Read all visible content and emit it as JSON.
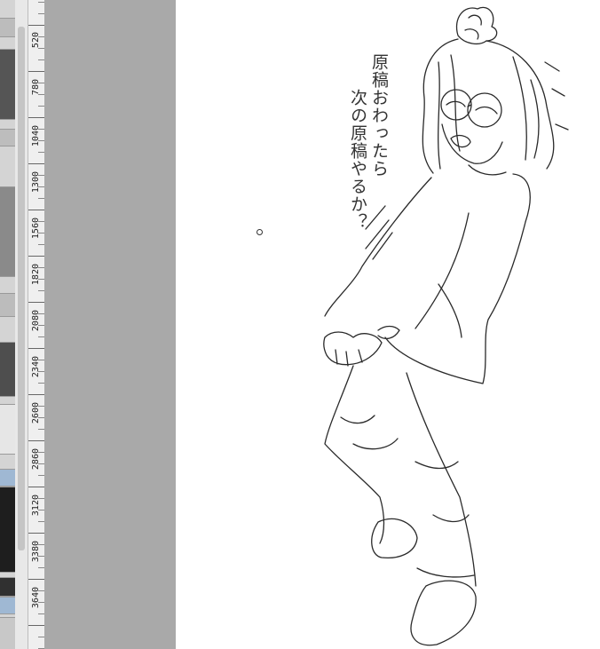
{
  "ruler": {
    "labels": [
      "520",
      "780",
      "1040",
      "1300",
      "1560",
      "1820",
      "2080",
      "2340",
      "2600",
      "2860",
      "3120",
      "3380",
      "3640"
    ]
  },
  "canvas": {
    "note_line_1": "原稿おわったら",
    "note_line_2": "次の原稿やるか？"
  },
  "colors": {
    "pasteboard": "#a9a9a9",
    "canvas": "#ffffff",
    "ruler": "#efefef",
    "ink": "#2a2a2a"
  },
  "icons": [
    "brush-cursor-icon"
  ]
}
